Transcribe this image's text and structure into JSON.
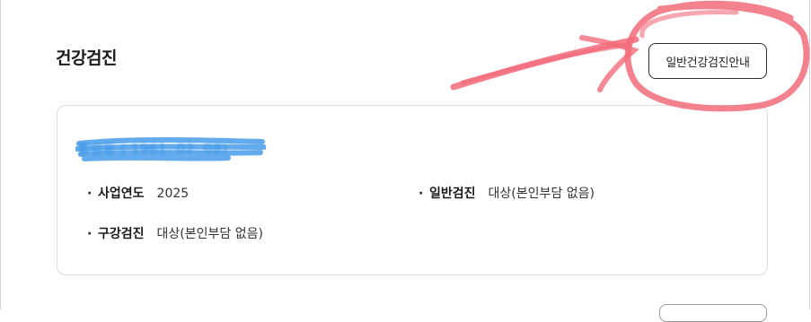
{
  "header": {
    "title": "건강검진",
    "guide_button_label": "일반건강검진안내"
  },
  "card": {
    "redacted_name": "홍길동 ( 1961. 02. 08)",
    "fields": [
      {
        "label": "사업연도",
        "value": "2025"
      },
      {
        "label": "일반검진",
        "value": "대상(본인부담 없음)"
      },
      {
        "label": "구강검진",
        "value": "대상(본인부담 없음)"
      }
    ]
  },
  "colors": {
    "annotation": "#f26b7a",
    "redaction": "#2f8fe6",
    "card_border": "#dcdcdc"
  }
}
